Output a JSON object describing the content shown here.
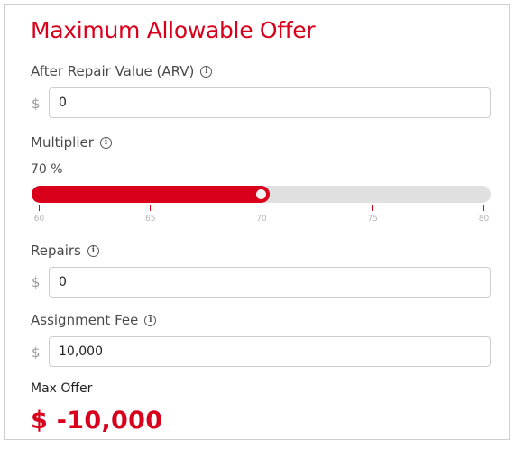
{
  "title": "Maximum Allowable Offer",
  "arv": {
    "label": "After Repair Value (ARV)",
    "currency": "$",
    "value": "0"
  },
  "multiplier": {
    "label": "Multiplier",
    "display": "70 %",
    "value": 70,
    "min": 60,
    "max": 80,
    "ticks": [
      "60",
      "65",
      "70",
      "75",
      "80"
    ]
  },
  "repairs": {
    "label": "Repairs",
    "currency": "$",
    "value": "0"
  },
  "assignment_fee": {
    "label": "Assignment Fee",
    "currency": "$",
    "value": "10,000"
  },
  "result": {
    "label": "Max Offer",
    "value": "$ -10,000"
  },
  "colors": {
    "accent": "#d9001b",
    "track": "#e0e0e0"
  },
  "icons": {
    "info": "info-circle-icon"
  }
}
